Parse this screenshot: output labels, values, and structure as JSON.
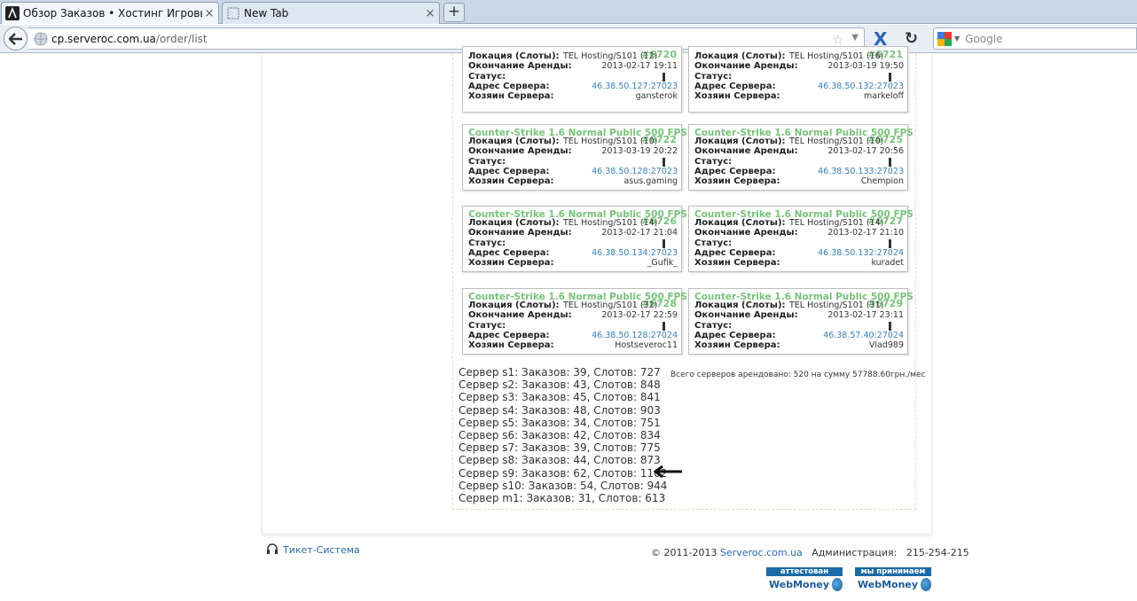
{
  "browser": {
    "tabs": [
      {
        "title": "Обзор Заказов • Хостинг Игровых Сер...",
        "active": true
      },
      {
        "title": "New Tab",
        "active": false
      }
    ],
    "new_tab": "+",
    "tab_close": "×",
    "url_host": "cp.serveroc.com.ua",
    "url_path": "/order/list",
    "search_placeholder": "Google"
  },
  "card_labels": {
    "location": "Локация (Слоты):",
    "end": "Окончание Аренды:",
    "status": "Статус:",
    "address": "Адрес Сервера:",
    "owner": "Хозяин Сервера:"
  },
  "cards": [
    {
      "title": "",
      "id": "#6720",
      "location": "TEL Hosting/S101 (12)",
      "end": "2013-02-17 19:11",
      "address": "46.38.50.127:27023",
      "owner": "gansterok"
    },
    {
      "title": "",
      "id": "#6721",
      "location": "TEL Hosting/S101 (16)",
      "end": "2013-03-19 19:50",
      "address": "46.38.50.132:27023",
      "owner": "markeloff"
    },
    {
      "title": "Counter-Strike 1.6 Normal Public 500 FPS",
      "id": "#6722",
      "location": "TEL Hosting/S101 (10)",
      "end": "2013-03-19 20:22",
      "address": "46.38.50.128:27023",
      "owner": "asus.gaming"
    },
    {
      "title": "Counter-Strike 1.6 Normal Public 500 FPS",
      "id": "#6725",
      "location": "TEL Hosting/S101 (10)",
      "end": "2013-02-17 20:56",
      "address": "46.38.50.133:27023",
      "owner": "Chempion"
    },
    {
      "title": "Counter-Strike 1.6 Normal Public 500 FPS",
      "id": "#6726",
      "location": "TEL Hosting/S101 (14)",
      "end": "2013-02-17 21:04",
      "address": "46.38.50.134:27023",
      "owner": "_Gufik_"
    },
    {
      "title": "Counter-Strike 1.6 Normal Public 500 FPS",
      "id": "#6727",
      "location": "TEL Hosting/S101 (14)",
      "end": "2013-02-17 21:10",
      "address": "46.38.50.132:27024",
      "owner": "kuradet"
    },
    {
      "title": "Counter-Strike 1.6 Normal Public 500 FPS",
      "id": "#6728",
      "location": "TEL Hosting/S101 (32)",
      "end": "2013-02-17 22:59",
      "address": "46.38.50.128:27024",
      "owner": "Hostseveroc11"
    },
    {
      "title": "Counter-Strike 1.6 Normal Public 500 FPS",
      "id": "#6729",
      "location": "TEL Hosting/S101 (31)",
      "end": "2013-02-17 23:11",
      "address": "46.38.57.40:27024",
      "owner": "Vlad989"
    }
  ],
  "stats": [
    "Сервер s1: Заказов: 39, Слотов: 727",
    "Сервер s2: Заказов: 43, Слотов: 848",
    "Сервер s3: Заказов: 45, Слотов: 841",
    "Сервер s4: Заказов: 48, Слотов: 903",
    "Сервер s5: Заказов: 34, Слотов: 751",
    "Сервер s6: Заказов: 42, Слотов: 834",
    "Сервер s7: Заказов: 39, Слотов: 775",
    "Сервер s8: Заказов: 44, Слотов: 873",
    "Сервер s9: Заказов: 62, Слотов: 1102",
    "Сервер s10: Заказов: 54, Слотов: 944",
    "Сервер m1: Заказов: 31, Слотов: 613"
  ],
  "total": "Всего серверов арендовано: 520 на сумму 57788.60грн./мес",
  "footer": {
    "ticket": "Тикет-Система",
    "copyright": "© 2011-2013",
    "brand": "Serveroc.com.ua",
    "admin": "Администрация:",
    "phone": "215-254-215",
    "badge1_top": "аттестован",
    "badge2_top": "мы принимаем",
    "badge_name": "WebMoney"
  },
  "colors": {
    "title_green": "#78c27a",
    "link_blue": "#2a6ca8",
    "webmoney_blue": "#1b6ba8"
  }
}
